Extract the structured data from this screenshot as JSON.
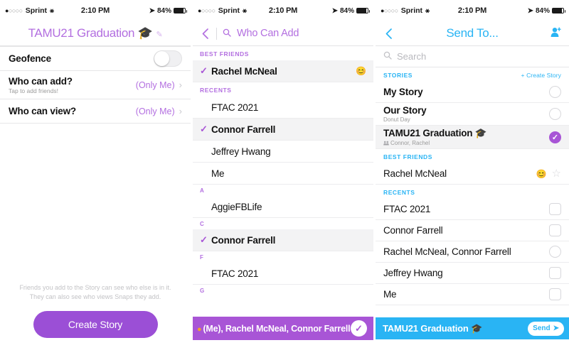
{
  "status_bar": {
    "carrier": "Sprint",
    "signal_dots_filled": 1,
    "signal_dots_total": 5,
    "wifi_icon": "wifi-icon",
    "time": "2:10 PM",
    "location_icon": "location-arrow-icon",
    "battery_percent": "84%",
    "battery_level": 84
  },
  "panel1": {
    "nav": {
      "back_icon": "chevron-left-icon",
      "title": "TAMU21 Graduation 🎓",
      "edit_icon": "pencil-icon"
    },
    "rows": [
      {
        "title": "Geofence",
        "subtitle": "",
        "control": "toggle",
        "toggle_on": false
      },
      {
        "title": "Who can add?",
        "subtitle": "Tap to add friends!",
        "control": "value",
        "value": "(Only Me)"
      },
      {
        "title": "Who can view?",
        "subtitle": "",
        "control": "value",
        "value": "(Only Me)"
      }
    ],
    "footer_note_line1": "Friends you add to the Story can see who else is in it.",
    "footer_note_line2": "They can also see who views Snaps they add.",
    "create_button": "Create Story"
  },
  "panel2": {
    "nav": {
      "back_icon": "chevron-left-icon",
      "search_icon": "search-icon",
      "title": "Who Can Add"
    },
    "sections": [
      {
        "header": "BEST FRIENDS",
        "header_style": "section",
        "items": [
          {
            "name": "Rachel McNeal",
            "checked": true,
            "emoji": "😊"
          }
        ]
      },
      {
        "header": "RECENTS",
        "header_style": "section",
        "items": [
          {
            "name": "FTAC 2021",
            "checked": false,
            "emoji": ""
          },
          {
            "name": "Connor Farrell",
            "checked": true,
            "emoji": ""
          },
          {
            "name": "Jeffrey Hwang",
            "checked": false,
            "emoji": ""
          },
          {
            "name": "Me",
            "checked": false,
            "emoji": ""
          }
        ]
      },
      {
        "header": "A",
        "header_style": "alpha",
        "items": [
          {
            "name": "AggieFBLife",
            "checked": false,
            "emoji": ""
          }
        ]
      },
      {
        "header": "C",
        "header_style": "alpha",
        "items": [
          {
            "name": "Connor Farrell",
            "checked": true,
            "emoji": ""
          }
        ]
      },
      {
        "header": "F",
        "header_style": "alpha",
        "items": [
          {
            "name": "FTAC 2021",
            "checked": false,
            "emoji": ""
          }
        ]
      },
      {
        "header": "G",
        "header_style": "alpha",
        "items": []
      }
    ],
    "bottom_bar": {
      "text": "(Me), Rachel McNeal, Connor Farrell",
      "confirm_icon": "check-circle-icon",
      "color": "#a855d6"
    }
  },
  "panel3": {
    "nav": {
      "back_icon": "chevron-left-icon",
      "title": "Send To...",
      "add_friend_icon": "add-person-icon"
    },
    "search": {
      "icon": "search-icon",
      "placeholder": "Search",
      "value": ""
    },
    "sections": [
      {
        "header": "STORIES",
        "action": "+ Create Story",
        "items": [
          {
            "title": "My Story",
            "subtitle": "",
            "selector": "circle",
            "selected": false,
            "emoji": "",
            "star": false
          },
          {
            "title": "Our Story",
            "subtitle": "Donut Day",
            "selector": "circle",
            "selected": false,
            "emoji": "",
            "star": false
          },
          {
            "title": "TAMU21 Graduation 🎓",
            "subtitle": "Connor, Rachel",
            "subtitle_icon": "group-icon",
            "selector": "circle",
            "selected": true,
            "emoji": "",
            "star": false,
            "highlighted": true
          }
        ]
      },
      {
        "header": "BEST FRIENDS",
        "action": "",
        "items": [
          {
            "title": "Rachel McNeal",
            "subtitle": "",
            "selector": "star",
            "selected": false,
            "emoji": "😊",
            "star": true
          }
        ]
      },
      {
        "header": "RECENTS",
        "action": "",
        "items": [
          {
            "title": "FTAC 2021",
            "subtitle": "",
            "selector": "square",
            "selected": false,
            "emoji": "",
            "star": false
          },
          {
            "title": "Connor Farrell",
            "subtitle": "",
            "selector": "square",
            "selected": false,
            "emoji": "",
            "star": false
          },
          {
            "title": "Rachel McNeal, Connor Farrell",
            "subtitle": "",
            "selector": "hex",
            "selected": false,
            "emoji": "",
            "star": false
          },
          {
            "title": "Jeffrey Hwang",
            "subtitle": "",
            "selector": "square",
            "selected": false,
            "emoji": "",
            "star": false
          },
          {
            "title": "Me",
            "subtitle": "",
            "selector": "square",
            "selected": false,
            "emoji": "",
            "star": false
          }
        ]
      }
    ],
    "bottom_bar": {
      "text": "TAMU21 Graduation 🎓",
      "send_label": "Send",
      "send_icon": "send-arrow-icon",
      "color": "#29b4f4"
    }
  },
  "colors": {
    "purple_accent": "#b36fe0",
    "purple_solid": "#a855d6",
    "purple_button": "#9b4fd6",
    "blue_accent": "#29b4f4",
    "text_primary": "#111111",
    "text_muted": "#9a9a9a",
    "divider": "#e6e6e8",
    "row_highlight": "#f3f3f4"
  }
}
